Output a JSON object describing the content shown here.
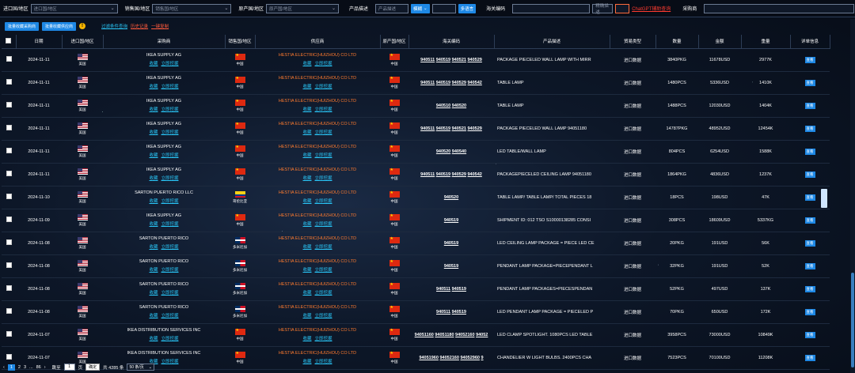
{
  "filters": {
    "import_label": "进口国/地区",
    "import_placeholder": "进口国/地区",
    "sales_label": "销售国/地区",
    "sales_placeholder": "销售国/地区",
    "origin_label": "原产国/地区",
    "origin_placeholder": "原产国/地区",
    "desc_label": "产品描述",
    "desc_placeholder": "产品描述",
    "fuzzy_label": "模糊",
    "multi_label": "多语言",
    "hs_label": "海关编码",
    "unit_label": "精确描述",
    "gpt_link": "ChatGPT辅助查询",
    "buyer_label": "采购商"
  },
  "toolbar": {
    "batch_buyer": "批量收藏采购商",
    "batch_supplier": "批量收藏供应商",
    "filter_query": "过滤条件查询",
    "history": "历史记录",
    "copy": "一键复制"
  },
  "headers": [
    "日期",
    "进口国/地区",
    "采购商",
    "销售国/地区",
    "供应商",
    "原产国/地区",
    "海关编码",
    "产品描述",
    "贸易类型",
    "数量",
    "金额",
    "重量",
    "详单信息"
  ],
  "row_labels": {
    "fav": "收藏",
    "contact": "立即挖掘",
    "view": "查看",
    "trade": "进口数据"
  },
  "rows": [
    {
      "date": "2024-11-11",
      "imp": "美国",
      "impf": "us",
      "buyer": "IKEA SUPPLY AG",
      "sales": "中国",
      "salesf": "cn",
      "supplier": "HESTIA ELECTRIC(HUIZHOU) CO LTD",
      "origin": "中国",
      "originf": "cn",
      "hs": [
        "940511",
        "940519",
        "940521",
        "940529"
      ],
      "desc": "PACKAGE PIECELED WALL LAMP WITH MIRR",
      "qty": "3840PKG",
      "amt": "11678USD",
      "wt": "2977K"
    },
    {
      "date": "2024-11-11",
      "imp": "美国",
      "impf": "us",
      "buyer": "IKEA SUPPLY AG",
      "sales": "中国",
      "salesf": "cn",
      "supplier": "HESTIA ELECTRIC(HUIZHOU) CO LTD",
      "origin": "中国",
      "originf": "cn",
      "hs": [
        "940511",
        "940519",
        "940529",
        "940542"
      ],
      "desc": "TABLE LAMP",
      "qty": "1480PCS",
      "amt": "5336USD",
      "wt": "1410K"
    },
    {
      "date": "2024-11-11",
      "imp": "美国",
      "impf": "us",
      "buyer": "IKEA SUPPLY AG",
      "sales": "中国",
      "salesf": "cn",
      "supplier": "HESTIA ELECTRIC(HUIZHOU) CO LTD",
      "origin": "中国",
      "originf": "cn",
      "hs": [
        "940510",
        "940520"
      ],
      "desc": "TABLE LAMP",
      "qty": "1488PCS",
      "amt": "12030USD",
      "wt": "1404K"
    },
    {
      "date": "2024-11-11",
      "imp": "美国",
      "impf": "us",
      "buyer": "IKEA SUPPLY AG",
      "sales": "中国",
      "salesf": "cn",
      "supplier": "HESTIA ELECTRIC(HUIZHOU) CO LTD",
      "origin": "中国",
      "originf": "cn",
      "hs": [
        "940511",
        "940519",
        "940521",
        "940529"
      ],
      "desc": "PACKAGE PIECELED WALL LAMP 94051180",
      "qty": "14787PKG",
      "amt": "48952USD",
      "wt": "12454K"
    },
    {
      "date": "2024-11-11",
      "imp": "美国",
      "impf": "us",
      "buyer": "IKEA SUPPLY AG",
      "sales": "中国",
      "salesf": "cn",
      "supplier": "HESTIA ELECTRIC(HUIZHOU) CO LTD",
      "origin": "中国",
      "originf": "cn",
      "hs": [
        "940520",
        "940540"
      ],
      "desc": "LED TABLE/WALL LAMP",
      "qty": "804PCS",
      "amt": "6254USD",
      "wt": "1588K"
    },
    {
      "date": "2024-11-11",
      "imp": "美国",
      "impf": "us",
      "buyer": "IKEA SUPPLY AG",
      "sales": "中国",
      "salesf": "cn",
      "supplier": "HESTIA ELECTRIC(HUIZHOU) CO LTD",
      "origin": "中国",
      "originf": "cn",
      "hs": [
        "940511",
        "940519",
        "940529",
        "940542"
      ],
      "desc": "PACKAGEPIECELED CEILING LAMP 94051180",
      "qty": "1864PKG",
      "amt": "4836USD",
      "wt": "1237K"
    },
    {
      "date": "2024-11-10",
      "imp": "美国",
      "impf": "us",
      "buyer": "SARTON PUERTO RICO LLC",
      "sales": "哥伦比亚",
      "salesf": "co",
      "supplier": "HESTIA ELECTRIC(HUIZHOU) CO LTD",
      "origin": "中国",
      "originf": "cn",
      "hs": [
        "940520"
      ],
      "desc": "TABLE LAMP/ TABLE LAMP/ TOTAL PIECES 18",
      "qty": "18PCS",
      "amt": "198USD",
      "wt": "47K"
    },
    {
      "date": "2024-11-09",
      "imp": "美国",
      "impf": "us",
      "buyer": "IKEA SUPPLY AG",
      "sales": "中国",
      "salesf": "cn",
      "supplier": "HESTIA ELECTRIC(HUIZHOU) CO LTD",
      "origin": "中国",
      "originf": "cn",
      "hs": [
        "940519"
      ],
      "desc": "SHIPMENT ID: 012 TSO S10000138285 CONSI",
      "qty": "308PCS",
      "amt": "18609USD",
      "wt": "5337KG"
    },
    {
      "date": "2024-11-08",
      "imp": "美国",
      "impf": "us",
      "buyer": "SARTON PUERTO RICO",
      "sales": "多米尼加",
      "salesf": "do",
      "supplier": "HESTIA ELECTRIC(HUIZHOU) CO LTD",
      "origin": "中国",
      "originf": "cn",
      "hs": [
        "940519"
      ],
      "desc": "LED CEILING LAMP PACKAGE = PIECE LED CE",
      "qty": "20PKG",
      "amt": "191USD",
      "wt": "56K"
    },
    {
      "date": "2024-11-08",
      "imp": "美国",
      "impf": "us",
      "buyer": "SARTON PUERTO RICO",
      "sales": "多米尼加",
      "salesf": "do",
      "supplier": "HESTIA ELECTRIC(HUIZHOU) CO LTD",
      "origin": "中国",
      "originf": "cn",
      "hs": [
        "940519"
      ],
      "desc": "PENDANT LAMP PACKAGE=PIECEPENDANT L",
      "qty": "32PKG",
      "amt": "191USD",
      "wt": "52K"
    },
    {
      "date": "2024-11-08",
      "imp": "美国",
      "impf": "us",
      "buyer": "SARTON PUERTO RICO",
      "sales": "多米尼加",
      "salesf": "do",
      "supplier": "HESTIA ELECTRIC(HUIZHOU) CO LTD",
      "origin": "中国",
      "originf": "cn",
      "hs": [
        "940511",
        "940519"
      ],
      "desc": "PENDANT LAMP PACKAGES=PIECESPENDAN",
      "qty": "52PKG",
      "amt": "497USD",
      "wt": "137K"
    },
    {
      "date": "2024-11-08",
      "imp": "美国",
      "impf": "us",
      "buyer": "SARTON PUERTO RICO",
      "sales": "多米尼加",
      "salesf": "do",
      "supplier": "HESTIA ELECTRIC(HUIZHOU) CO LTD",
      "origin": "中国",
      "originf": "cn",
      "hs": [
        "940511",
        "940519"
      ],
      "desc": "LED PENDANT LAMP PACKAGE = PIECELED P",
      "qty": "70PKG",
      "amt": "650USD",
      "wt": "172K"
    },
    {
      "date": "2024-11-07",
      "imp": "美国",
      "impf": "us",
      "buyer": "IKEA DISTRIBUTION SERVICES INC",
      "sales": "中国",
      "salesf": "cn",
      "supplier": "HESTIA ELECTRIC(HUIZHOU) CO LTD",
      "origin": "中国",
      "originf": "cn",
      "hs": [
        "94051160",
        "94051180",
        "94052160",
        "94052"
      ],
      "desc": "LED CLAMP SPOTLIGHT. 1080PCS LED TABLE",
      "qty": "3958PCS",
      "amt": "73000USD",
      "wt": "10849K"
    },
    {
      "date": "2024-11-07",
      "imp": "美国",
      "impf": "us",
      "buyer": "IKEA DISTRIBUTION SERVICES INC",
      "sales": "中国",
      "salesf": "cn",
      "supplier": "HESTIA ELECTRIC(HUIZHOU) CO LTD",
      "origin": "中国",
      "originf": "cn",
      "hs": [
        "94051960",
        "94052160",
        "94052960",
        "9"
      ],
      "desc": "CHANDELIER W LIGHT BULBS. 2400PCS CHA",
      "qty": "7523PCS",
      "amt": "70100USD",
      "wt": "11208K"
    }
  ],
  "pager": {
    "pages": [
      "1",
      "2",
      "3",
      "...",
      "86"
    ],
    "goto_label": "跳至",
    "goto_value": "1",
    "page_unit": "页",
    "confirm": "确定",
    "total": "共 4285 条",
    "per_page": "50 条/页"
  },
  "colors": {
    "accent": "#1e88e5",
    "supplier": "#ff7b2e",
    "link": "#29c5f6",
    "warn": "#ff3b30"
  }
}
